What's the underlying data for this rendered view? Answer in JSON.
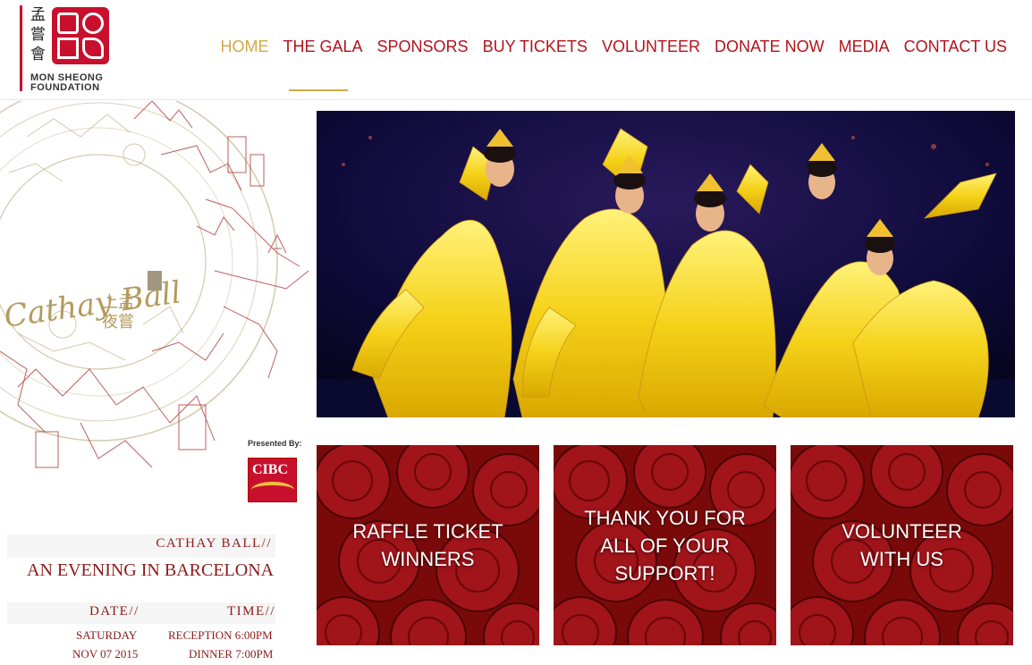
{
  "logo": {
    "chinese_chars": "孟嘗會",
    "name_line1": "MON SHEONG",
    "name_line2": "FOUNDATION"
  },
  "nav": {
    "items": [
      {
        "label": "HOME",
        "active": true
      },
      {
        "label": "THE GALA",
        "active": false
      },
      {
        "label": "SPONSORS",
        "active": false
      },
      {
        "label": "BUY TICKETS",
        "active": false
      },
      {
        "label": "VOLUNTEER",
        "active": false
      },
      {
        "label": "DONATE NOW",
        "active": false
      },
      {
        "label": "MEDIA",
        "active": false
      },
      {
        "label": "CONTACT US",
        "active": false
      }
    ]
  },
  "art": {
    "title": "Cathay Ball",
    "chinese": "上孟 夜嘗"
  },
  "sponsor": {
    "presented_by": "Presented By:",
    "cibc": "CIBC"
  },
  "event": {
    "name": "CATHAY BALL//",
    "subtitle": "AN EVENING IN BARCELONA",
    "date_label": "DATE//",
    "time_label": "TIME//",
    "day": "SATURDAY",
    "date": "NOV 07 2015",
    "reception": "RECEPTION 6:00PM",
    "dinner": "DINNER 7:00PM"
  },
  "tiles": [
    {
      "label": "RAFFLE TICKET WINNERS"
    },
    {
      "label": "THANK YOU FOR ALL OF YOUR SUPPORT!"
    },
    {
      "label": "VOLUNTEER WITH US"
    }
  ],
  "colors": {
    "brand_red": "#c8102e",
    "nav_red": "#b5121b",
    "gold": "#d4a944",
    "text_red": "#8b1a1a"
  }
}
